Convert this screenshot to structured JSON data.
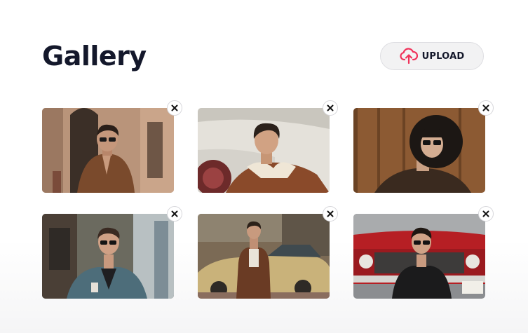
{
  "header": {
    "title": "Gallery",
    "upload_label": "UPLOAD",
    "upload_icon": "cloud-upload-icon",
    "accent": "#f0325a"
  },
  "gallery": {
    "items": [
      {
        "name": "street-portrait-brown-shirt",
        "remove_icon": "close-icon",
        "palette": [
          "#b9947a",
          "#8a6a52",
          "#6a4a36",
          "#2b211b"
        ]
      },
      {
        "name": "vintage-car-shearling-jacket",
        "remove_icon": "close-icon",
        "palette": [
          "#d6d3cc",
          "#a6a39d",
          "#8a4a2a",
          "#2b211b"
        ]
      },
      {
        "name": "wood-wall-black-hat",
        "remove_icon": "close-icon",
        "palette": [
          "#8c5a33",
          "#6b4324",
          "#3a2a1f",
          "#1c1714"
        ]
      },
      {
        "name": "city-street-grey-blazer",
        "remove_icon": "close-icon",
        "palette": [
          "#6b6a5f",
          "#b8c0c2",
          "#4d6d7a",
          "#3a3431"
        ]
      },
      {
        "name": "yellow-car-brown-suit",
        "remove_icon": "close-icon",
        "palette": [
          "#7b6a55",
          "#c9b27a",
          "#6a3b24",
          "#2e2a26"
        ]
      },
      {
        "name": "red-car-leather-jacket",
        "remove_icon": "close-icon",
        "palette": [
          "#b61f24",
          "#d7d6d2",
          "#1b1b1c",
          "#8b8d90"
        ]
      }
    ]
  }
}
